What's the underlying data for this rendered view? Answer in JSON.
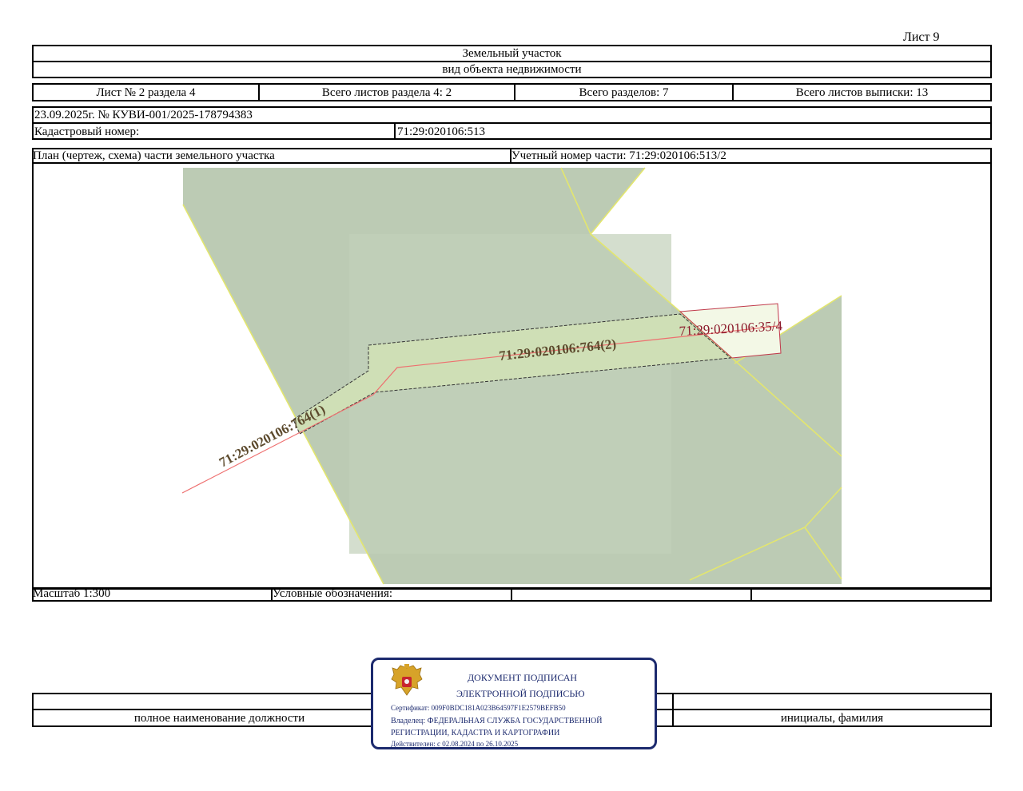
{
  "sheet_label": "Лист 9",
  "header": {
    "object_title": "Земельный участок",
    "object_kind": "вид объекта недвижимости"
  },
  "sections": {
    "sheet_of_section": "Лист № 2 раздела 4",
    "total_sheets_section": "Всего листов раздела 4: 2",
    "total_sections": "Всего разделов: 7",
    "total_sheets_extract": "Всего листов выписки: 13"
  },
  "doc_info": {
    "date_number": "23.09.2025г. № КУВИ-001/2025-178794383",
    "cadastral_label": "Кадастровый номер:",
    "cadastral_value": "71:29:020106:513"
  },
  "plan": {
    "title": "План (чертеж, схема) части земельного участка",
    "part_number": "Учетный номер части: 71:29:020106:513/2",
    "labels": {
      "part1": "71:29:020106:764(1)",
      "part2": "71:29:020106:764(2)",
      "neighbor": "71:29:020106:35/4"
    },
    "colors": {
      "parcel_fill": "#bccbb4",
      "strip_fill": "#cfdfb6",
      "neighbor_fill": "#f3f8e6",
      "border_yellow": "#e3e66e",
      "axis_red": "#ee6f6f",
      "label_brown": "#5c4a2d",
      "label_red": "#8b1a2b"
    }
  },
  "footer_row": {
    "scale": "Масштаб 1:300",
    "legend": "Условные обозначения:"
  },
  "signature": {
    "position_caption": "полное наименование должности",
    "name_caption": "инициалы, фамилия"
  },
  "stamp": {
    "line1": "ДОКУМЕНТ ПОДПИСАН",
    "line2": "ЭЛЕКТРОННОЙ ПОДПИСЬЮ",
    "certificate": "Сертификат: 009F0BDC181A023B64597F1E2579BEFB50",
    "owner_line1": "Владелец: ФЕДЕРАЛЬНАЯ СЛУЖБА ГОСУДАРСТВЕННОЙ",
    "owner_line2": "РЕГИСТРАЦИИ, КАДАСТРА И КАРТОГРАФИИ",
    "validity": "Действителен: с 02.08.2024 по 26.10.2025",
    "emblem_icon": "coat-of-arms-icon",
    "color": "#1c2a6e"
  }
}
